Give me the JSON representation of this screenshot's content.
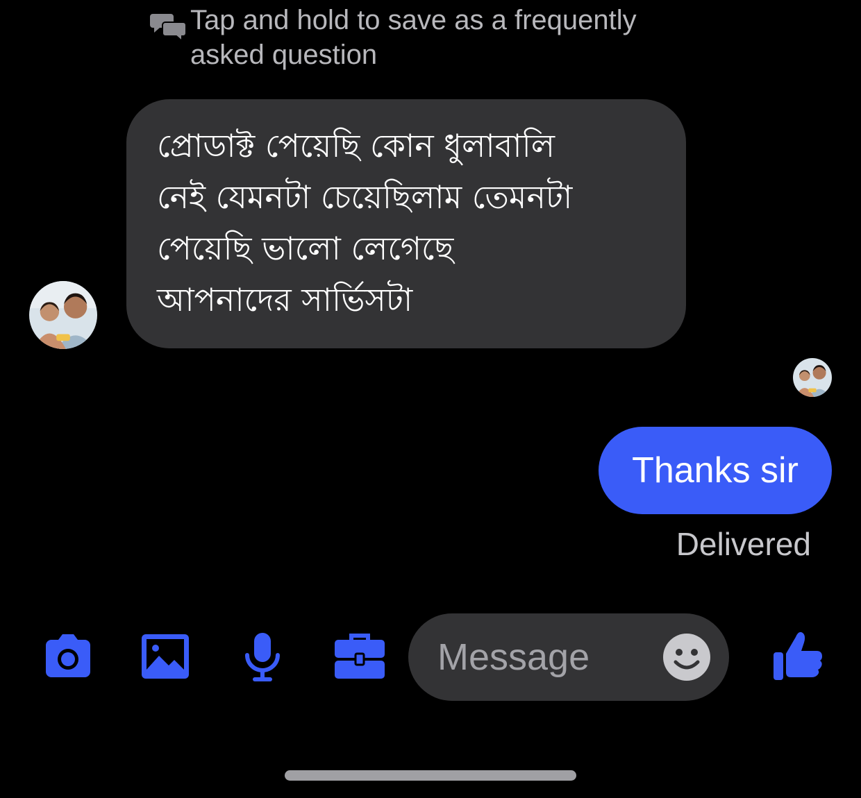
{
  "faq_hint": {
    "text": "Tap and hold to save as a frequently\nasked question",
    "icon": "chat-bubbles-icon"
  },
  "conversation": {
    "incoming": {
      "lines": [
        "প্রোডাক্ট পেয়েছি কোন ধুলাবালি",
        "নেই যেমনটা চেয়েছিলাম তেমনটা",
        "পেয়েছি ভালো লেগেছে",
        "আপনাদের সার্ভিসটা"
      ],
      "bubble_color": "#333335",
      "avatar": "contact-avatar"
    },
    "outgoing": {
      "text": "Thanks sir",
      "bubble_color": "#3a5cf8",
      "status": "Delivered"
    },
    "seen_avatar": "seen-avatar"
  },
  "composer": {
    "placeholder": "Message",
    "icons": [
      "camera-icon",
      "gallery-icon",
      "microphone-icon",
      "briefcase-icon",
      "emoji-icon",
      "like-icon"
    ],
    "accent": "#3a5cf8"
  }
}
